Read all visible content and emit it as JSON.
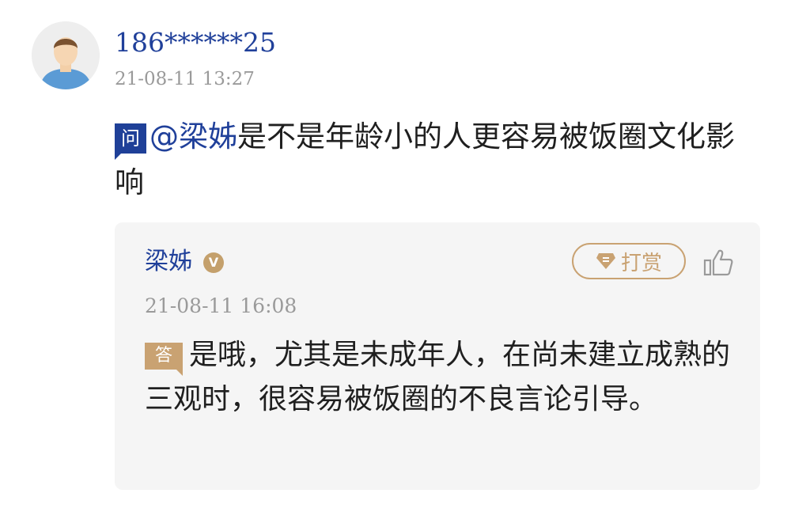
{
  "question": {
    "username": "186******25",
    "time": "21-08-11 13:27",
    "badge": "问",
    "mention": "@梁姊",
    "text": "是不是年龄小的人更容易被饭圈文化影响"
  },
  "answer": {
    "author": "梁姊",
    "verified_icon": "V",
    "tip_label": "打赏",
    "time": "21-08-11 16:08",
    "badge": "答",
    "text": "是哦，尤其是未成年人，在尚未建立成熟的三观时，很容易被饭圈的不良言论引导。"
  },
  "colors": {
    "link_blue": "#20409a",
    "gold": "#c9a272",
    "card_bg": "#f5f5f5",
    "meta_gray": "#9a9a9a"
  }
}
